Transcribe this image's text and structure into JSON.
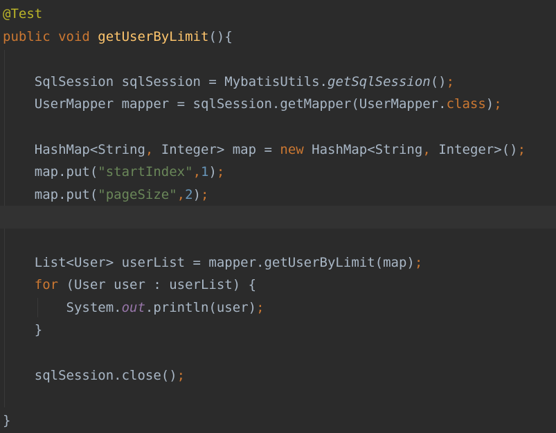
{
  "editor": {
    "lines": [
      {
        "tokens": [
          {
            "t": "@Test",
            "c": "annotation"
          }
        ]
      },
      {
        "tokens": [
          {
            "t": "public ",
            "c": "keyword"
          },
          {
            "t": "void ",
            "c": "keyword"
          },
          {
            "t": "getUserByLimit",
            "c": "method"
          },
          {
            "t": "(){",
            "c": "plain"
          }
        ]
      },
      {
        "tokens": []
      },
      {
        "tokens": [
          {
            "t": "    SqlSession sqlSession = MybatisUtils.",
            "c": "plain"
          },
          {
            "t": "getSqlSession",
            "c": "italic"
          },
          {
            "t": "()",
            "c": "plain"
          },
          {
            "t": ";",
            "c": "punct"
          }
        ]
      },
      {
        "tokens": [
          {
            "t": "    UserMapper mapper = sqlSession.getMapper(UserMapper.",
            "c": "plain"
          },
          {
            "t": "class",
            "c": "keyword"
          },
          {
            "t": ")",
            "c": "plain"
          },
          {
            "t": ";",
            "c": "punct"
          }
        ]
      },
      {
        "tokens": []
      },
      {
        "tokens": [
          {
            "t": "    HashMap<String",
            "c": "plain"
          },
          {
            "t": ", ",
            "c": "punct"
          },
          {
            "t": "Integer> map = ",
            "c": "plain"
          },
          {
            "t": "new ",
            "c": "keyword"
          },
          {
            "t": "HashMap<String",
            "c": "plain"
          },
          {
            "t": ", ",
            "c": "punct"
          },
          {
            "t": "Integer>()",
            "c": "plain"
          },
          {
            "t": ";",
            "c": "punct"
          }
        ]
      },
      {
        "tokens": [
          {
            "t": "    map.put(",
            "c": "plain"
          },
          {
            "t": "\"startIndex\"",
            "c": "string"
          },
          {
            "t": ",",
            "c": "punct"
          },
          {
            "t": "1",
            "c": "number"
          },
          {
            "t": ")",
            "c": "plain"
          },
          {
            "t": ";",
            "c": "punct"
          }
        ]
      },
      {
        "tokens": [
          {
            "t": "    map.put(",
            "c": "plain"
          },
          {
            "t": "\"pageSize\"",
            "c": "string"
          },
          {
            "t": ",",
            "c": "punct"
          },
          {
            "t": "2",
            "c": "number"
          },
          {
            "t": ")",
            "c": "plain"
          },
          {
            "t": ";",
            "c": "punct"
          }
        ]
      },
      {
        "tokens": [],
        "current": true
      },
      {
        "tokens": []
      },
      {
        "tokens": [
          {
            "t": "    List<User> userList = mapper.getUserByLimit(map)",
            "c": "plain"
          },
          {
            "t": ";",
            "c": "punct"
          }
        ]
      },
      {
        "tokens": [
          {
            "t": "    ",
            "c": "plain"
          },
          {
            "t": "for ",
            "c": "keyword"
          },
          {
            "t": "(User user : userList) {",
            "c": "plain"
          }
        ]
      },
      {
        "tokens": [
          {
            "t": "        System.",
            "c": "plain"
          },
          {
            "t": "out",
            "c": "static"
          },
          {
            "t": ".println(user)",
            "c": "plain"
          },
          {
            "t": ";",
            "c": "punct"
          }
        ]
      },
      {
        "tokens": [
          {
            "t": "    }",
            "c": "plain"
          }
        ]
      },
      {
        "tokens": []
      },
      {
        "tokens": [
          {
            "t": "    sqlSession.close()",
            "c": "plain"
          },
          {
            "t": ";",
            "c": "punct"
          }
        ]
      },
      {
        "tokens": []
      },
      {
        "tokens": [
          {
            "t": "}",
            "c": "plain"
          }
        ]
      }
    ]
  },
  "colors": {
    "background": "#2b2b2b",
    "current_line": "#323232",
    "plain": "#a9b7c6",
    "keyword": "#cc7832",
    "method": "#ffc66d",
    "annotation": "#bbb529",
    "string": "#6a8759",
    "number": "#6897bb",
    "static_field": "#9876aa"
  }
}
